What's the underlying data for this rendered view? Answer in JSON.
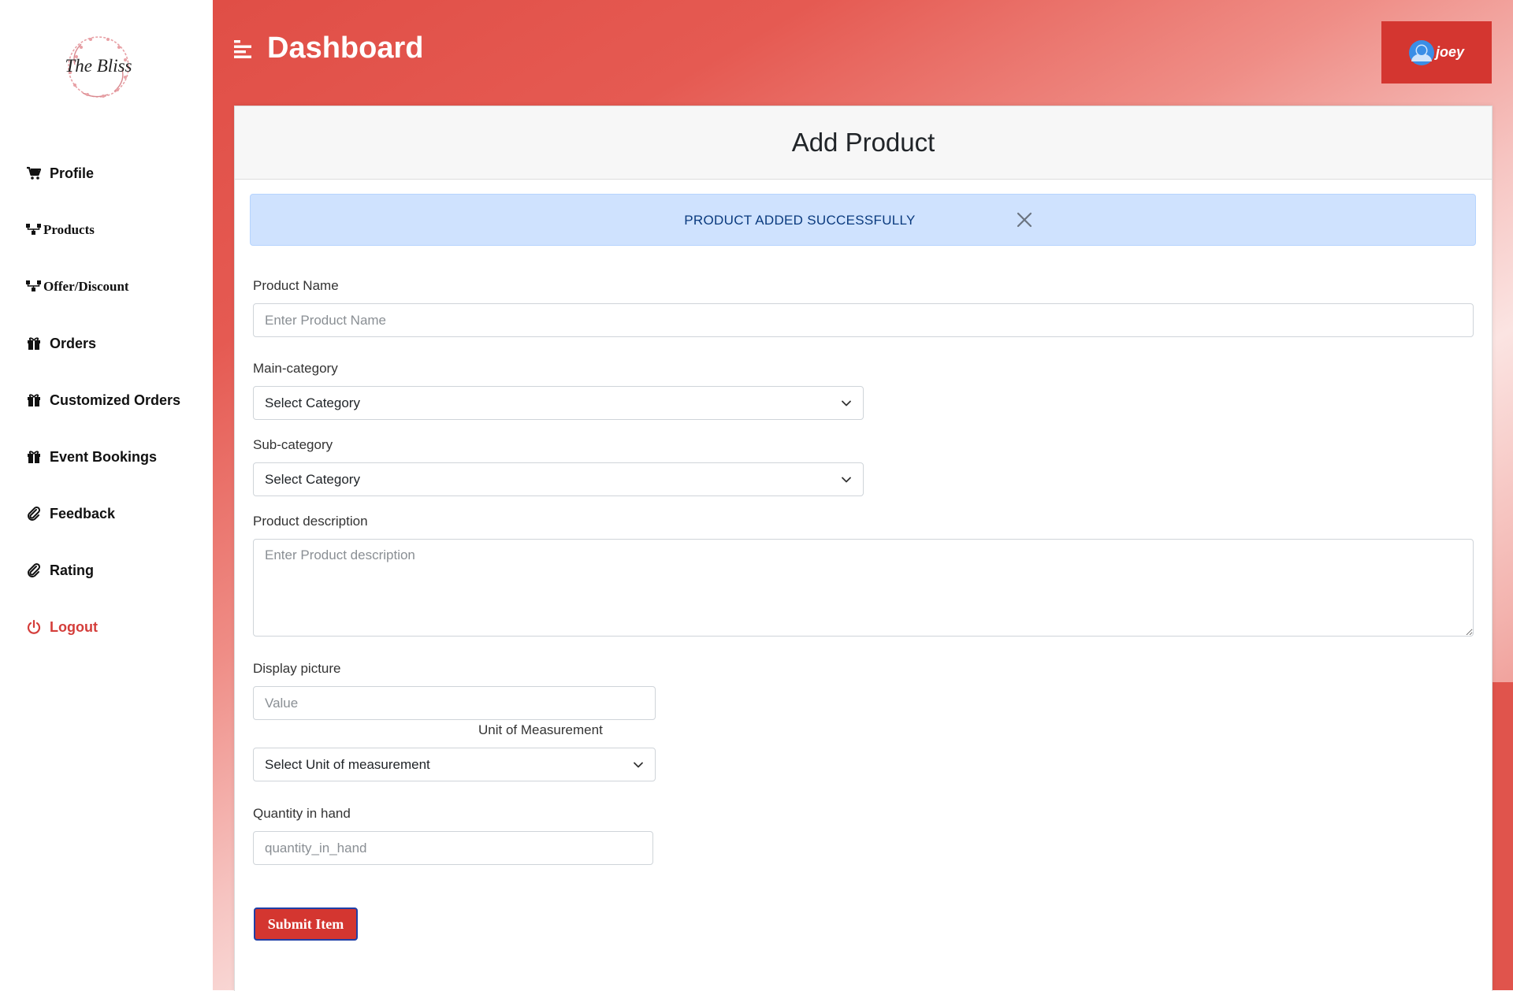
{
  "sidebar": {
    "logo_text": "The Bliss",
    "items": [
      {
        "label": "Profile",
        "icon": "cart-icon"
      },
      {
        "label": "Products",
        "icon": "sitemap-icon"
      },
      {
        "label": "Offer/Discount",
        "icon": "sitemap-icon"
      },
      {
        "label": "Orders",
        "icon": "gift-icon"
      },
      {
        "label": "Customized Orders",
        "icon": "gift-icon"
      },
      {
        "label": "Event Bookings",
        "icon": "gift-icon"
      },
      {
        "label": "Feedback",
        "icon": "paperclip-icon"
      },
      {
        "label": "Rating",
        "icon": "paperclip-icon"
      },
      {
        "label": "Logout",
        "icon": "power-icon"
      }
    ]
  },
  "header": {
    "title": "Dashboard",
    "user_name": "joey"
  },
  "card": {
    "title": "Add Product",
    "alert": "PRODUCT ADDED SUCCESSFULLY"
  },
  "form": {
    "product_name": {
      "label": "Product Name",
      "placeholder": "Enter Product Name",
      "value": ""
    },
    "main_category": {
      "label": "Main-category",
      "selected": "Select Category"
    },
    "sub_category": {
      "label": "Sub-category",
      "selected": "Select Category"
    },
    "description": {
      "label": "Product description",
      "placeholder": "Enter Product description",
      "value": ""
    },
    "display_picture": {
      "label": "Display picture",
      "placeholder": "Value",
      "value": ""
    },
    "unit": {
      "label": "Unit of Measurement",
      "selected": "Select Unit of measurement"
    },
    "quantity": {
      "label": "Quantity in hand",
      "placeholder": "quantity_in_hand",
      "value": ""
    },
    "submit_label": "Submit Item"
  },
  "colors": {
    "accent": "#d43630",
    "logout": "#d43d3a",
    "alert_bg": "#cfe2fe",
    "alert_text": "#0a3a7e"
  }
}
